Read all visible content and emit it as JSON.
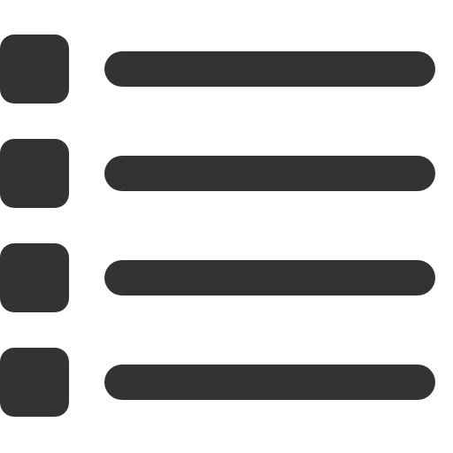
{
  "icon": {
    "name": "list-icon",
    "item_count": 4,
    "colors": {
      "foreground": "#333333",
      "background": "#ffffff"
    }
  }
}
